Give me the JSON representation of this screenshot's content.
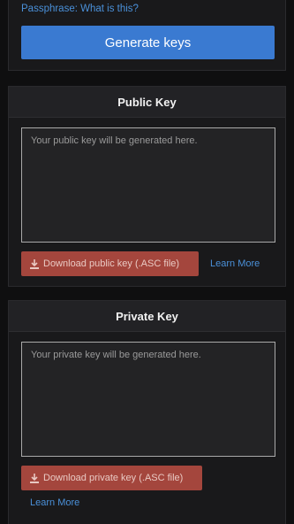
{
  "top": {
    "passphrase_link": "Passphrase: What is this?",
    "generate_label": "Generate keys"
  },
  "public_key": {
    "title": "Public Key",
    "placeholder": "Your public key will be generated here.",
    "download_label": "Download public key (.ASC file)",
    "learn_more": "Learn More"
  },
  "private_key": {
    "title": "Private Key",
    "placeholder": "Your private key will be generated here.",
    "download_label": "Download private key (.ASC file)",
    "learn_more": "Learn More"
  },
  "icons": {
    "download": "download-icon"
  },
  "colors": {
    "accent_blue": "#3a7ad1",
    "link_blue": "#4a90d9",
    "download_red": "#a4463d",
    "background": "#0f0f10",
    "card": "#19191b"
  }
}
